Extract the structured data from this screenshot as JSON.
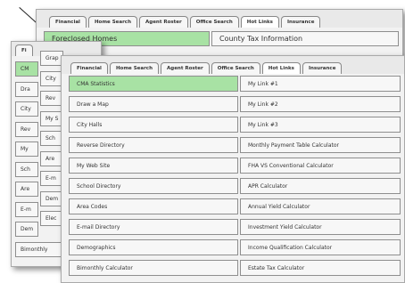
{
  "back_panel": {
    "tabs": [
      "Financial",
      "Home Search",
      "Agent Roster",
      "Office Search",
      "Hot Links",
      "Insurance"
    ],
    "row1": [
      "Foreclosed Homes",
      "County Tax Information"
    ]
  },
  "middle_panel": {
    "tab": "Fi",
    "left_col": [
      "CM",
      "Dra",
      "City",
      "Rev",
      "My",
      "Sch",
      "Are",
      "E-m",
      "Dem",
      "Bimonthly"
    ],
    "inner_col": [
      "Grap",
      "City",
      "Rev",
      "My S",
      "Sch",
      "Are",
      "E-m",
      "Dem",
      "Elec"
    ]
  },
  "front_panel": {
    "tabs": [
      "Financial",
      "Home Search",
      "Agent Roster",
      "Office Search",
      "Hot Links",
      "Insurance"
    ],
    "left": [
      "CMA Statistics",
      "Draw a Map",
      "City Halls",
      "Reverse Directory",
      "My Web Site",
      "School Directory",
      "Area Codes",
      "E-mail Directory",
      "Demographics",
      "Bimonthly Calculator"
    ],
    "right": [
      "My Link #1",
      "My Link #2",
      "My Link #3",
      "Monthly Payment Table Calculator",
      "FHA VS Conventional Calculator",
      "APR Calculator",
      "Annual Yield Calculator",
      "Investment Yield Calculator",
      "Income Qualification Calculator",
      "Estate Tax Calculator"
    ]
  },
  "colors": {
    "selected": "#a8e2a4",
    "cell": "#f7f7f7",
    "border": "#8e8e8e"
  }
}
